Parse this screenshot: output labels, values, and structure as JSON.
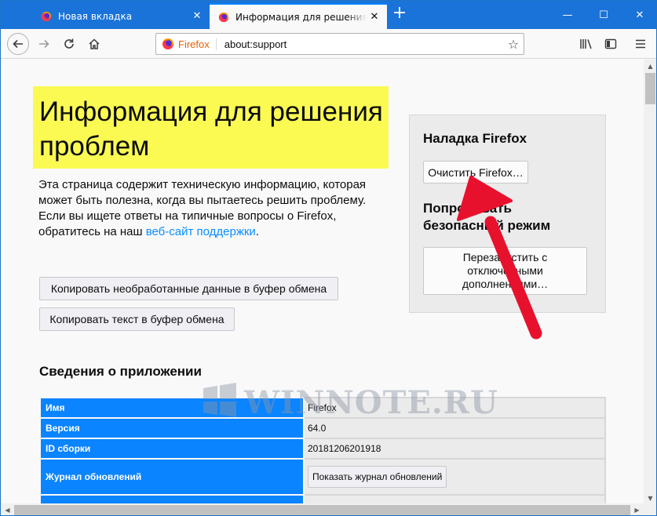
{
  "tabs": [
    {
      "title": "Новая вкладка",
      "active": false
    },
    {
      "title": "Информация для решения проблем",
      "active": true
    }
  ],
  "window_controls": {
    "minimize": "—",
    "maximize": "☐",
    "close": "✕"
  },
  "urlbar": {
    "identity": "Firefox",
    "url": "about:support"
  },
  "page": {
    "title": "Информация для решения проблем",
    "intro": "Эта страница содержит техническую информацию, которая может быть полезна, когда вы пытаетесь решить проблему. Если вы ищете ответы на типичные вопросы о Firefox, обратитесь на наш ",
    "support_link": "веб-сайт поддержки",
    "intro_end": ".",
    "copy_raw_button": "Копировать необработанные данные в буфер обмена",
    "copy_text_button": "Копировать текст в буфер обмена"
  },
  "sidebox": {
    "refresh_heading": "Наладка Firefox",
    "refresh_button": "Очистить Firefox…",
    "safe_mode_heading": "Попробовать безопасный режим",
    "restart_button": "Перезапустить с отключёнными дополнениями…"
  },
  "app_section": {
    "heading": "Сведения о приложении",
    "rows": [
      {
        "label": "Имя",
        "value": "Firefox"
      },
      {
        "label": "Версия",
        "value": "64.0"
      },
      {
        "label": "ID сборки",
        "value": "20181206201918"
      },
      {
        "label": "Журнал обновлений",
        "button": "Показать журнал обновлений"
      }
    ]
  },
  "watermark": "WINNOTE.RU",
  "colors": {
    "tabbar": "#1a73d8",
    "title_highlight": "#fafa53",
    "table_header": "#0a84ff",
    "arrow": "#e8112d"
  }
}
